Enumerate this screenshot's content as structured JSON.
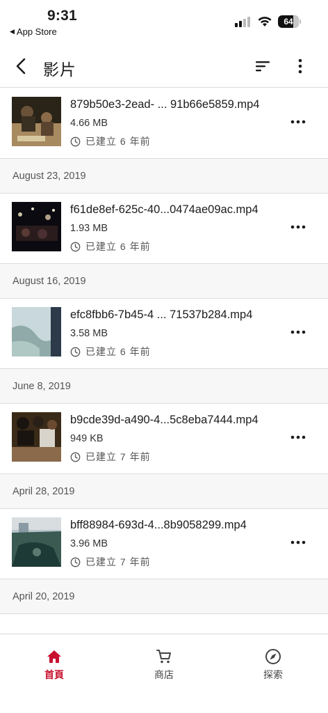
{
  "status_bar": {
    "time": "9:31",
    "back_app": "App Store",
    "battery": "64"
  },
  "nav": {
    "title": "影片",
    "icons": [
      "back-chevron-icon",
      "sort-icon",
      "more-vertical-icon"
    ]
  },
  "items": [
    {
      "filename": "879b50e3-2ead- ... 91b66e5859.mp4",
      "size": "4.66 MB",
      "created": "已建立 6 年前",
      "thumb_colors": [
        "#2a2418",
        "#a88a60",
        "#3a3022"
      ]
    },
    {
      "date": "August 23, 2019"
    },
    {
      "filename": "f61de8ef-625c-40...0474ae09ac.mp4",
      "size": "1.93 MB",
      "created": "已建立 6 年前",
      "thumb_colors": [
        "#0a0a10",
        "#3a2a2a",
        "#1a1418"
      ]
    },
    {
      "date": "August 16, 2019"
    },
    {
      "filename": "efc8fbb6-7b45-4 ... 71537b284.mp4",
      "size": "3.58 MB",
      "created": "已建立 6 年前",
      "thumb_colors": [
        "#c8d8dc",
        "#8faaa8",
        "#2c3a4a"
      ]
    },
    {
      "date": "June 8, 2019"
    },
    {
      "filename": "b9cde39d-a490-4...5c8eba7444.mp4",
      "size": "949 KB",
      "created": "已建立 7 年前",
      "thumb_colors": [
        "#3a2a18",
        "#8a6a4a",
        "#1a1410"
      ]
    },
    {
      "date": "April 28, 2019"
    },
    {
      "filename": "bff88984-693d-4...8b9058299.mp4",
      "size": "3.96 MB",
      "created": "已建立 7 年前",
      "thumb_colors": [
        "#b8c4cc",
        "#3a5a52",
        "#1e3a36"
      ]
    },
    {
      "date": "April 20, 2019"
    }
  ],
  "tabs": [
    {
      "label": "首頁",
      "icon": "home-icon",
      "active": true
    },
    {
      "label": "商店",
      "icon": "cart-icon",
      "active": false
    },
    {
      "label": "探索",
      "icon": "compass-icon",
      "active": false
    }
  ],
  "colors": {
    "accent": "#c8102e",
    "divider": "#dcdcdc",
    "section_bg": "#f7f7f7"
  }
}
